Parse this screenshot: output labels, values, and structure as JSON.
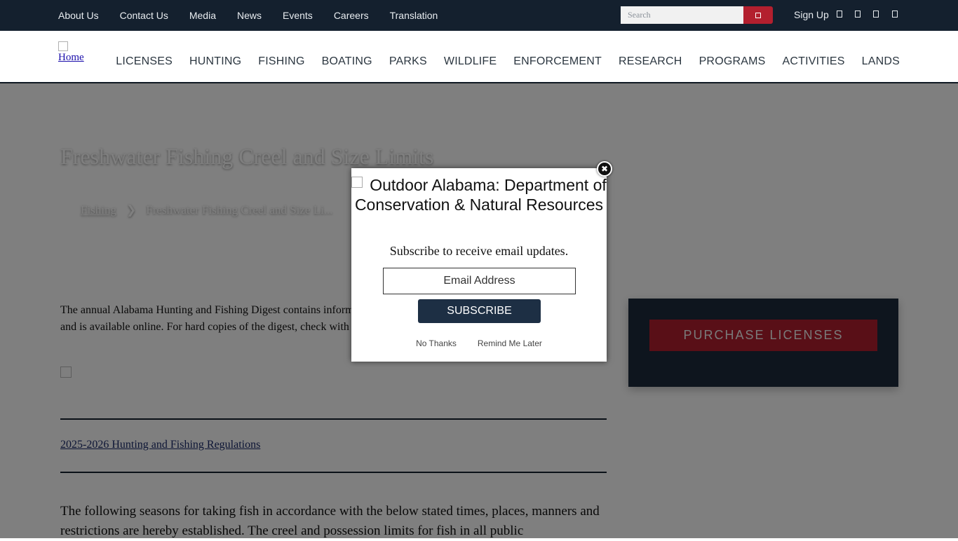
{
  "topbar": {
    "links": [
      "About Us",
      "Contact Us",
      "Media",
      "News",
      "Events",
      "Careers",
      "Translation"
    ],
    "search_placeholder": "Search",
    "signup_label": "Sign Up",
    "social_icons": [
      "social-icon-1",
      "social-icon-2",
      "social-icon-3",
      "social-icon-4"
    ]
  },
  "nav": {
    "logo_alt": "Home",
    "items": [
      "LICENSES",
      "HUNTING",
      "FISHING",
      "BOATING",
      "PARKS",
      "WILDLIFE",
      "ENFORCEMENT",
      "RESEARCH",
      "PROGRAMS",
      "ACTIVITIES",
      "LANDS"
    ]
  },
  "page": {
    "title": "Freshwater Fishing Creel and Size Limits",
    "breadcrumb": {
      "parent": "Fishing",
      "separator": "❯",
      "current": "Freshwater Fishing Creel and Size Li..."
    },
    "intro": "The annual Alabama Hunting and Fishing Digest contains information on fishing regulations, license fees and size limits and is available online. For hard copies of the digest, check with license agents or use the links below:",
    "regulations_link": "2025-2026 Hunting and Fishing Regulations",
    "body_text": "The following seasons for taking fish in accordance with the below stated times, places, manners and restrictions are hereby established. The creel and possession limits for fish in all public"
  },
  "sidebar": {
    "purchase_label": "PURCHASE LICENSES"
  },
  "modal": {
    "heading": "Outdoor Alabama: Department of Conservation & Natural Resources",
    "subtitle": "Subscribe to receive email updates.",
    "email_placeholder": "Email Address",
    "subscribe_label": "SUBSCRIBE",
    "no_thanks_label": "No Thanks",
    "remind_label": "Remind Me Later",
    "close_symbol": "✖"
  },
  "colors": {
    "navy": "#14202e",
    "accent_red": "#b31f2e",
    "sidebar_bg": "#1d2b3c",
    "subscribe_bg": "#1d2f44"
  }
}
